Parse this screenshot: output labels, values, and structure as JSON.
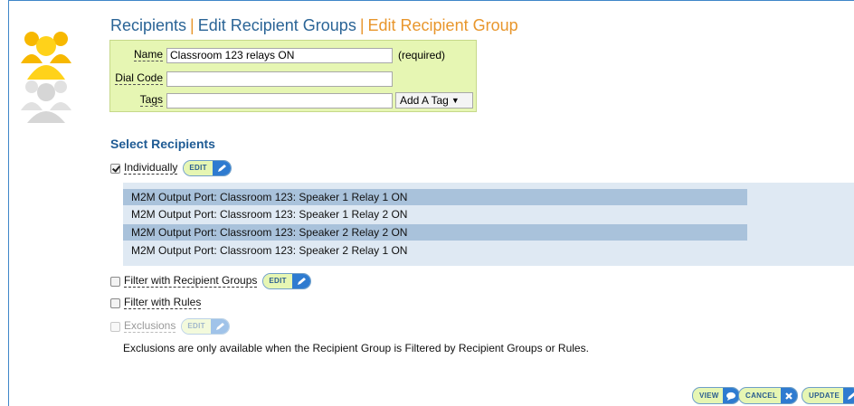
{
  "breadcrumb": {
    "recipients": "Recipients",
    "edit_groups": "Edit Recipient Groups",
    "current": "Edit Recipient Group",
    "separator": "|"
  },
  "form": {
    "name_label": "Name",
    "name_value": "Classroom 123 relays ON",
    "required_text": "(required)",
    "dialcode_label": "Dial Code",
    "dialcode_value": "",
    "tags_label": "Tags",
    "tags_value": "",
    "add_tag_select": "Add A Tag"
  },
  "select_recipients": {
    "title": "Select Recipients",
    "individually": {
      "label": "Individually",
      "checked": true,
      "edit_label": "EDIT"
    },
    "recipients": [
      "M2M Output Port: Classroom 123: Speaker 1 Relay 1 ON",
      "M2M Output Port: Classroom 123: Speaker 1 Relay 2 ON",
      "M2M Output Port: Classroom 123: Speaker 2 Relay 2 ON",
      "M2M Output Port: Classroom 123: Speaker 2 Relay 1 ON"
    ],
    "filter_groups": {
      "label": "Filter with Recipient Groups",
      "checked": false,
      "edit_label": "EDIT"
    },
    "filter_rules": {
      "label": "Filter with Rules",
      "checked": false
    },
    "exclusions": {
      "label": "Exclusions",
      "checked": false,
      "disabled": true,
      "edit_label": "EDIT"
    },
    "exclusions_note": "Exclusions are only available when the Recipient Group is Filtered by Recipient Groups or Rules."
  },
  "actions": {
    "view": "VIEW",
    "cancel": "CANCEL",
    "update": "UPDATE"
  },
  "colors": {
    "accent_blue": "#2e7bd0",
    "title_blue": "#2a6496",
    "orange": "#e8962c",
    "form_bg": "#e6f6b3",
    "row_highlight": "#a9c2db"
  }
}
